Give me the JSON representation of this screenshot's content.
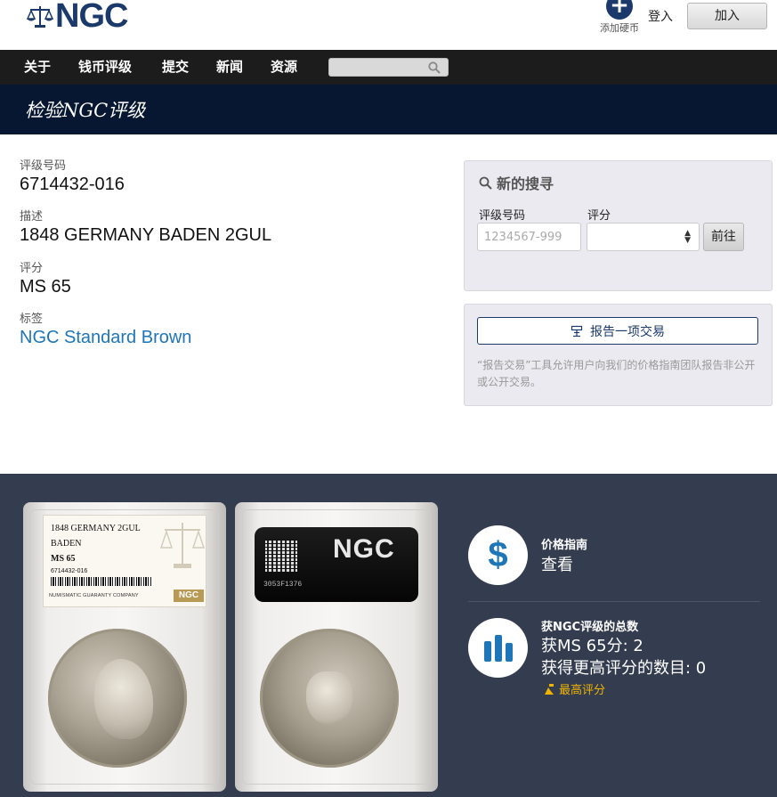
{
  "brand": {
    "logo_text": "NGC"
  },
  "header": {
    "add_coin_label": "添加硬币",
    "login_label": "登入",
    "join_label": "加入"
  },
  "nav": {
    "items": [
      "关于",
      "钱币评级",
      "提交",
      "新闻",
      "资源"
    ],
    "search_placeholder": ""
  },
  "page_title": "检验NGC评级",
  "details": {
    "cert_label": "评级号码",
    "cert_value": "6714432-016",
    "desc_label": "描述",
    "desc_value": "1848 GERMANY BADEN 2GUL",
    "grade_label": "评分",
    "grade_value": "MS 65",
    "label_label": "标签",
    "label_value": "NGC Standard Brown"
  },
  "new_search": {
    "title": "新的搜寻",
    "cert_label": "评级号码",
    "cert_placeholder": "1234567-999",
    "grade_label": "评分",
    "grade_selected": "",
    "go_label": "前往"
  },
  "report": {
    "button_label": "报告一项交易",
    "note": "“报告交易”工具允许用户向我们的价格指南团队报告非公开或公开交易。"
  },
  "slab_front": {
    "line1": "1848 GERMANY 2GUL",
    "line2": "BADEN",
    "grade": "MS 65",
    "cert": "6714432-016",
    "company": "NUMISMATIC GUARANTY COMPANY",
    "logo": "NGC"
  },
  "slab_back": {
    "logo": "NGC",
    "serial": "3053F1376"
  },
  "price_guide": {
    "title": "价格指南",
    "link": "查看"
  },
  "population": {
    "title": "获NGC评级的总数",
    "at_grade": "获MS 65分: 2",
    "higher": "获得更高评分的数目: 0",
    "top_pop": "最高评分"
  },
  "colors": {
    "brand_navy": "#1b3a6b",
    "nav_bg": "#1c1c1c",
    "title_band": "#071631",
    "link_blue": "#1e76b8",
    "dark_section": "#343c50",
    "top_pop_gold": "#f0b400"
  }
}
